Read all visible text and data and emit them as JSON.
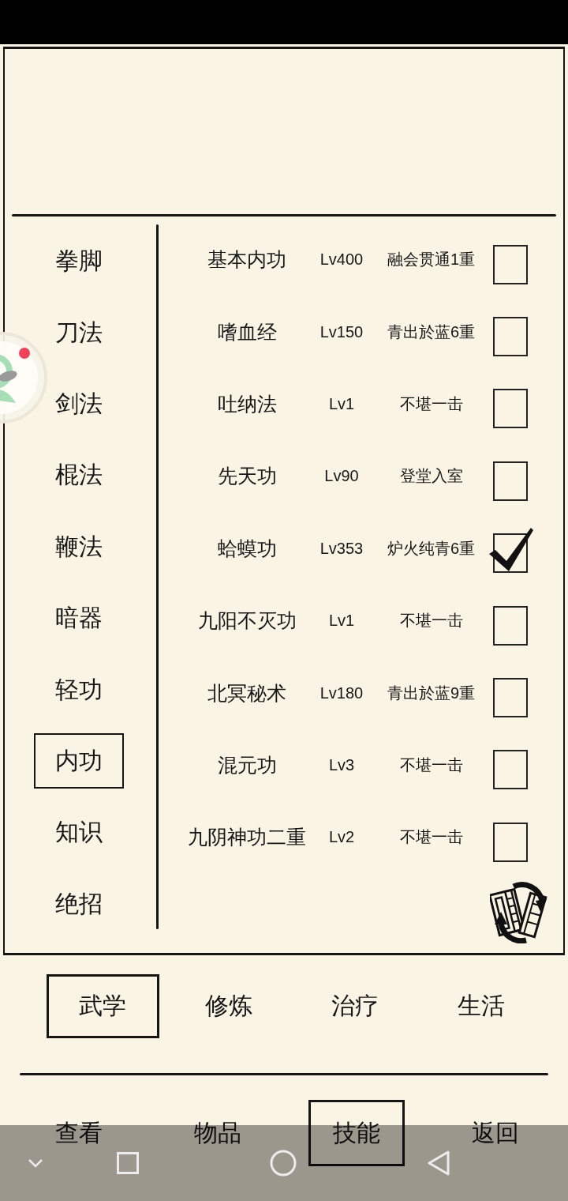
{
  "categories": [
    {
      "label": "拳脚",
      "selected": false
    },
    {
      "label": "刀法",
      "selected": false
    },
    {
      "label": "剑法",
      "selected": false
    },
    {
      "label": "棍法",
      "selected": false
    },
    {
      "label": "鞭法",
      "selected": false
    },
    {
      "label": "暗器",
      "selected": false
    },
    {
      "label": "轻功",
      "selected": false
    },
    {
      "label": "内功",
      "selected": true
    },
    {
      "label": "知识",
      "selected": false
    },
    {
      "label": "绝招",
      "selected": false
    }
  ],
  "skills": [
    {
      "name": "基本内功",
      "grade": "Lv400",
      "rank": "融会贯通1重",
      "checked": false
    },
    {
      "name": "嗜血经",
      "grade": "Lv150",
      "rank": "青出於蓝6重",
      "checked": false
    },
    {
      "name": "吐纳法",
      "grade": "Lv1",
      "rank": "不堪一击",
      "checked": false
    },
    {
      "name": "先天功",
      "grade": "Lv90",
      "rank": "登堂入室",
      "checked": false
    },
    {
      "name": "蛤蟆功",
      "grade": "Lv353",
      "rank": "炉火纯青6重",
      "checked": true
    },
    {
      "name": "九阳不灭功",
      "grade": "Lv1",
      "rank": "不堪一击",
      "checked": false
    },
    {
      "name": "北冥秘术",
      "grade": "Lv180",
      "rank": "青出於蓝9重",
      "checked": false
    },
    {
      "name": "混元功",
      "grade": "Lv3",
      "rank": "不堪一击",
      "checked": false
    },
    {
      "name": "九阴神功二重",
      "grade": "Lv2",
      "rank": "不堪一击",
      "checked": false
    }
  ],
  "section_tabs": [
    {
      "label": "武学",
      "selected": true
    },
    {
      "label": "修炼",
      "selected": false
    },
    {
      "label": "治疗",
      "selected": false
    },
    {
      "label": "生活",
      "selected": false
    }
  ],
  "bottom_nav": [
    {
      "label": "查看",
      "selected": false
    },
    {
      "label": "物品",
      "selected": false
    },
    {
      "label": "技能",
      "selected": true
    },
    {
      "label": "返回",
      "selected": false
    }
  ],
  "floating_button": {
    "badge": true
  }
}
